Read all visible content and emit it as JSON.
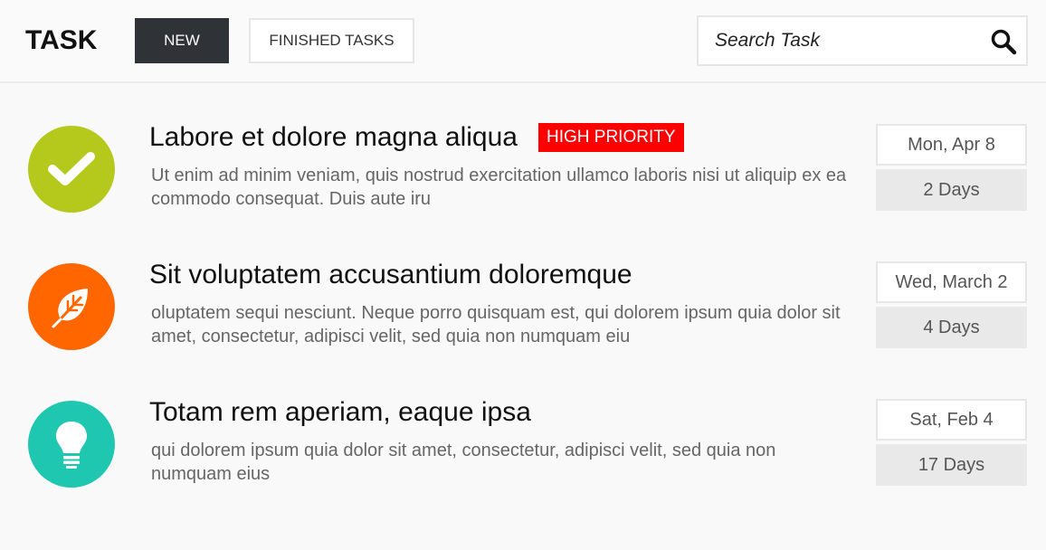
{
  "header": {
    "title": "TASK",
    "tabs": [
      {
        "label": "NEW"
      },
      {
        "label": "FINISHED TASKS"
      }
    ],
    "search": {
      "placeholder": "Search Task"
    }
  },
  "tasks": [
    {
      "title": "Labore et dolore magna aliqua",
      "badge": "HIGH PRIORITY",
      "description": "Ut enim ad minim veniam, quis nostrud exercitation ullamco laboris nisi ut aliquip ex ea commodo consequat. Duis aute iru",
      "date": "Mon, Apr 8",
      "days": "2 Days",
      "icon": "check-icon",
      "color": "#b5c91d"
    },
    {
      "title": "Sit voluptatem accusantium doloremque",
      "description": "oluptatem sequi nesciunt. Neque porro quisquam est, qui dolorem ipsum quia dolor sit amet, consectetur, adipisci velit, sed quia non numquam eiu",
      "date": "Wed, March 2",
      "days": "4 Days",
      "icon": "leaf-icon",
      "color": "#ff6600"
    },
    {
      "title": "Totam rem aperiam, eaque ipsa",
      "description": "qui dolorem ipsum quia dolor sit amet, consectetur, adipisci velit, sed quia non numquam eius",
      "date": "Sat, Feb 4",
      "days": "17 Days",
      "icon": "lightbulb-icon",
      "color": "#1fc7b0"
    }
  ],
  "colors": {
    "active_tab": "#2f3338",
    "priority": "#ff0000"
  }
}
